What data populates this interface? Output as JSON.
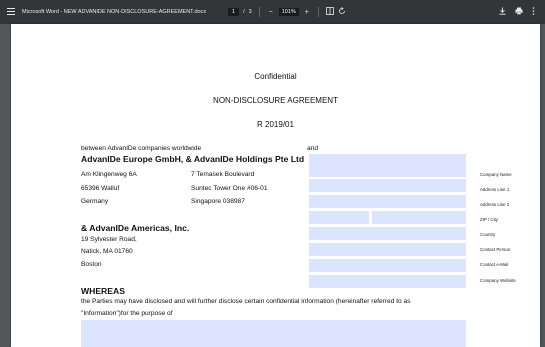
{
  "toolbar": {
    "title": "Microsoft Word - NEW ADVANIDE NON-DISCLOSURE-AGREEMENT.docx",
    "page_current": "1",
    "page_sep": "/",
    "page_total": "3",
    "zoom_out": "−",
    "zoom": "101%",
    "zoom_in": "+",
    "fit_icon": "fit-page-icon",
    "rotate_icon": "rotate-icon",
    "download_icon": "download-icon",
    "print_icon": "print-icon",
    "more_icon": "more-vert-icon"
  },
  "doc": {
    "header1": "Confidential",
    "header2": "NON-DISCLOSURE AGREEMENT",
    "header3": "R 2019/01",
    "between": "between AdvanIDe companies worldwide",
    "and": "and",
    "company_line": "AdvanIDe Europe GmbH, & AdvanIDe Holdings  Pte Ltd",
    "eu_addr": [
      "Am Klingenweg 6A",
      "65396 Walluf",
      "Germany"
    ],
    "sg_addr": [
      "7 Temasek Boulevard",
      "Suntec Tower One #06-01",
      "Singapore 038987"
    ],
    "americas": "& AdvanIDe Americas, Inc.",
    "us_addr": [
      "19 Sylvester Road,",
      "Natick, MA 01760",
      "Boston"
    ],
    "whereas": "WHEREAS",
    "body1": "the Parties may have disclosed and will further disclose certain confidential information (hereinafter referred to as",
    "body2": "\"Information\")for the purpose of"
  },
  "form_labels": {
    "company_name": "Company Name",
    "address1": "Address Line 1",
    "address2": "Address Line 2",
    "zip_city": "ZIP / City",
    "country": "Country",
    "contact_person": "Contact Person",
    "contact_email": "Contact e-Mail",
    "website": "Company Website"
  },
  "colors": {
    "toolbar_bg": "#323639",
    "field_bg": "#dde4ff",
    "viewer_bg": "#525659"
  }
}
